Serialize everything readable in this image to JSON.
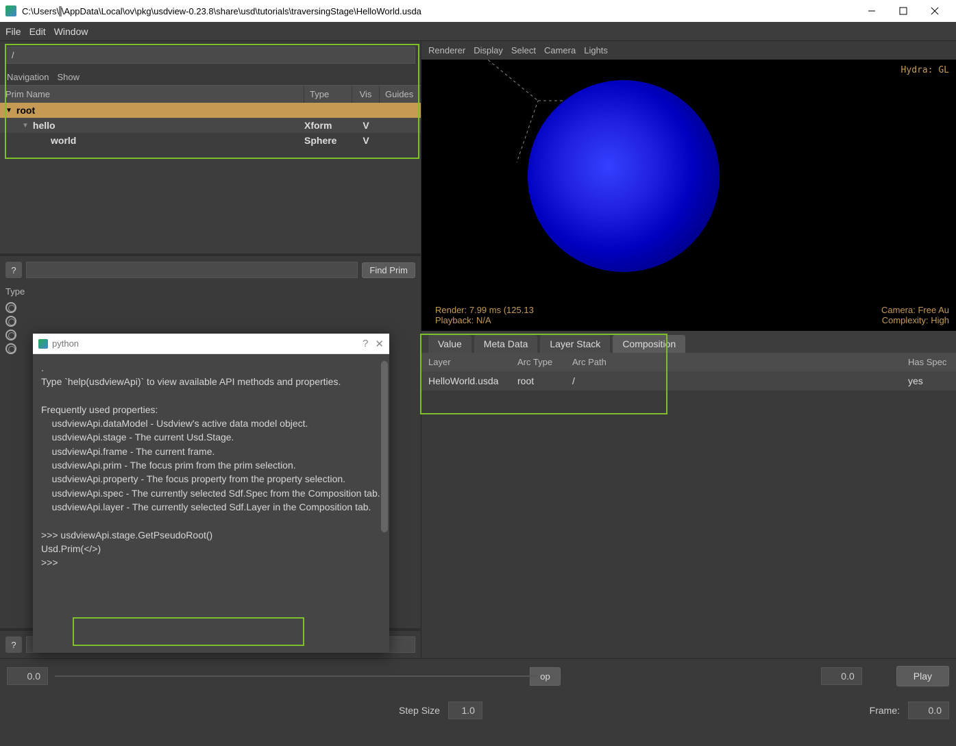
{
  "titlebar": {
    "path_prefix": "C:\\Users\\",
    "redacted": "          ",
    "path_suffix": "\\AppData\\Local\\ov\\pkg\\usdview-0.23.8\\share\\usd\\tutorials\\traversingStage\\HelloWorld.usda"
  },
  "menubar": [
    "File",
    "Edit",
    "Window"
  ],
  "path_input": "/",
  "nav": [
    "Navigation",
    "Show"
  ],
  "tree_headers": {
    "name": "Prim Name",
    "type": "Type",
    "vis": "Vis",
    "guides": "Guides"
  },
  "tree": [
    {
      "name": "root",
      "type": "",
      "vis": "",
      "indent": 0,
      "selected": true,
      "arrow": "▼"
    },
    {
      "name": "hello",
      "type": "Xform",
      "vis": "V",
      "indent": 1,
      "arrow": "▼"
    },
    {
      "name": "world",
      "type": "Sphere",
      "vis": "V",
      "indent": 2,
      "arrow": ""
    }
  ],
  "find_label": "Find Prim",
  "type_label": "Type",
  "vp_menu": [
    "Renderer",
    "Display",
    "Select",
    "Camera",
    "Lights"
  ],
  "vp_overlay": {
    "tr": "Hydra: GL",
    "bl_l1": "Render: 7.99 ms (125.13",
    "bl_l2": "Playback: N/A",
    "br_l1": "Camera: Free Au",
    "br_l2": "Complexity: High"
  },
  "tabs": [
    "Value",
    "Meta Data",
    "Layer Stack",
    "Composition"
  ],
  "active_tab": 3,
  "comp_headers": {
    "layer": "Layer",
    "arc": "Arc Type",
    "path": "Arc Path",
    "spec": "Has Spec"
  },
  "comp_rows": [
    {
      "layer": "HelloWorld.usda",
      "arc": "root",
      "path": "/",
      "spec": "yes"
    }
  ],
  "bottom": {
    "val_left": "0.0",
    "val_right": "0.0",
    "play": "Play",
    "step_label": "Step Size",
    "step_val": "1.0",
    "frame_label": "Frame:",
    "frame_val": "0.0",
    "stop": "op"
  },
  "py": {
    "title": "python",
    "body_lines": [
      ".",
      "Type `help(usdviewApi)` to view available API methods and properties.",
      "",
      "Frequently used properties:",
      "    usdviewApi.dataModel - Usdview's active data model object.",
      "    usdviewApi.stage - The current Usd.Stage.",
      "    usdviewApi.frame - The current frame.",
      "    usdviewApi.prim - The focus prim from the prim selection.",
      "    usdviewApi.property - The focus property from the property selection.",
      "    usdviewApi.spec - The currently selected Sdf.Spec from the Composition tab.",
      "    usdviewApi.layer - The currently selected Sdf.Layer in the Composition tab.",
      "",
      ">>> usdviewApi.stage.GetPseudoRoot()",
      "Usd.Prim(</>)",
      ">>> "
    ]
  }
}
